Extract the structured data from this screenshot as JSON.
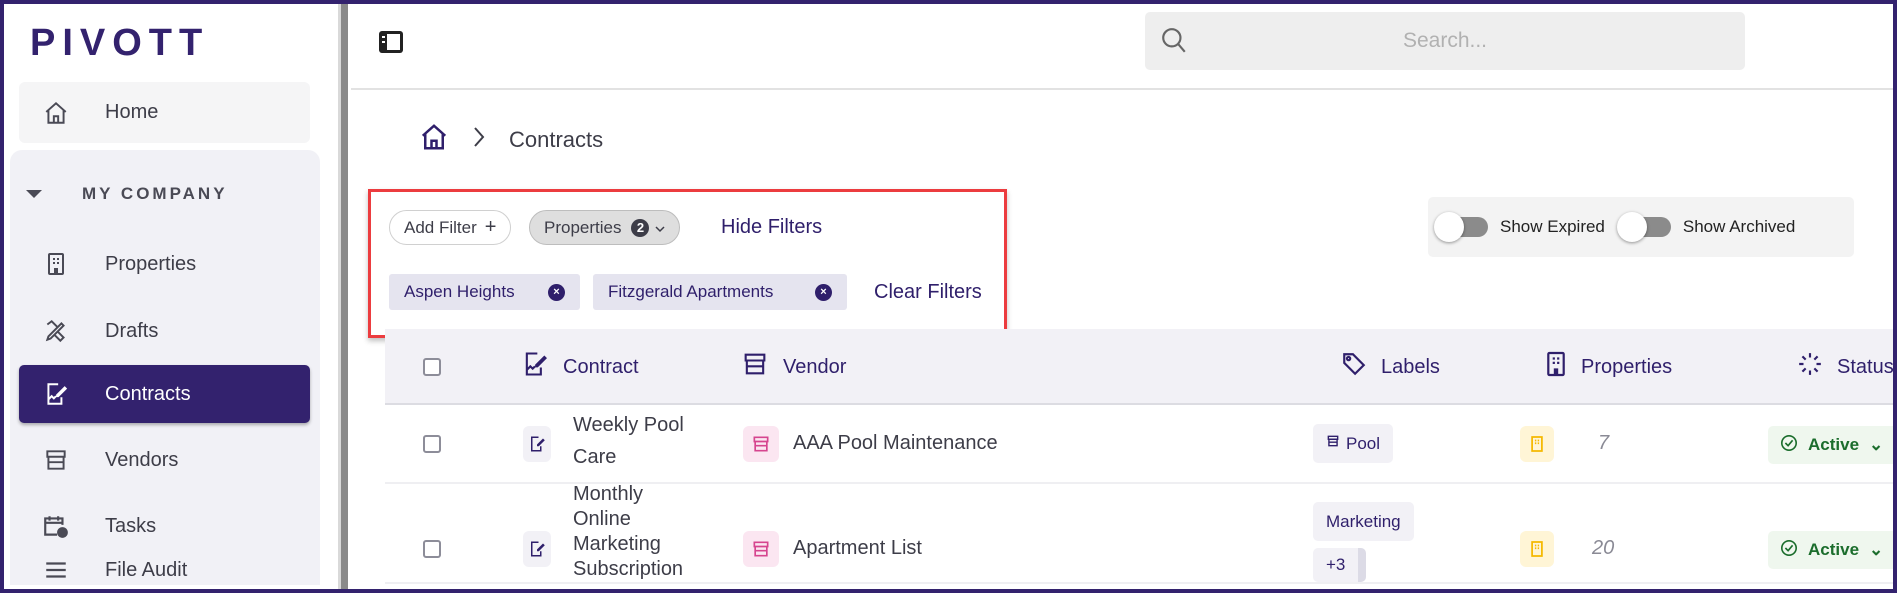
{
  "brand": "PIVOTT",
  "sidebar": {
    "home": "Home",
    "section": "MY COMPANY",
    "items": [
      {
        "label": "Properties",
        "icon": "building-icon"
      },
      {
        "label": "Drafts",
        "icon": "pencil-ruler-icon"
      },
      {
        "label": "Contracts",
        "icon": "contract-icon",
        "active": true
      },
      {
        "label": "Vendors",
        "icon": "store-icon"
      },
      {
        "label": "Tasks",
        "icon": "calendar-clock-icon"
      },
      {
        "label": "File Audit",
        "icon": "file-audit-icon"
      }
    ]
  },
  "topbar": {
    "search_placeholder": "Search..."
  },
  "breadcrumb": {
    "current": "Contracts"
  },
  "filters": {
    "add_filter": "Add Filter",
    "properties": "Properties",
    "properties_count": "2",
    "hide_filters": "Hide Filters",
    "chips": [
      "Aspen Heights",
      "Fitzgerald Apartments"
    ],
    "clear_filters": "Clear Filters"
  },
  "toggles": {
    "show_expired": "Show Expired",
    "show_archived": "Show Archived"
  },
  "table": {
    "headers": {
      "contract": "Contract",
      "vendor": "Vendor",
      "labels": "Labels",
      "properties": "Properties",
      "status": "Status"
    },
    "rows": [
      {
        "contract": "Weekly Pool Care",
        "vendor": "AAA Pool Maintenance",
        "label": "Pool",
        "extra": "",
        "properties": "7",
        "status": "Active"
      },
      {
        "contract": "Monthly Online Marketing Subscription",
        "vendor": "Apartment List",
        "label": "Marketing",
        "extra": "+3",
        "properties": "20",
        "status": "Active"
      }
    ]
  },
  "colors": {
    "brand": "#33226e",
    "accent_text": "#2f1f6b",
    "vendor_icon": "#d6458f",
    "property_icon": "#f5b800",
    "active": "#1b6d2c",
    "highlight": "#ec3c3f"
  }
}
